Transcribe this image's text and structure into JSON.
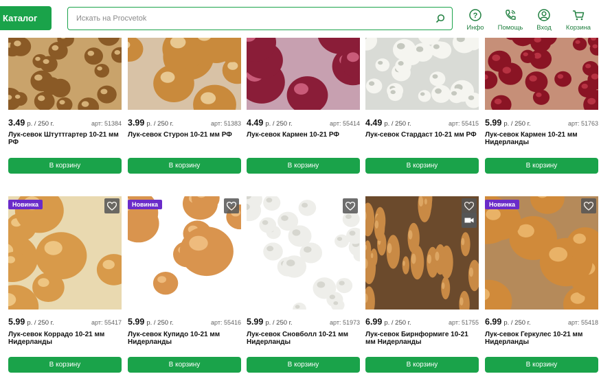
{
  "header": {
    "catalog_label": "Каталог",
    "search_placeholder": "Искать на Procvetok",
    "nav": [
      {
        "label": "Инфо",
        "icon": "info-icon"
      },
      {
        "label": "Помощь",
        "icon": "phone-icon"
      },
      {
        "label": "Вход",
        "icon": "user-icon"
      },
      {
        "label": "Корзина",
        "icon": "cart-icon"
      }
    ]
  },
  "colors": {
    "accent": "#1aa34a",
    "badge": "#6a2bc9"
  },
  "products": [
    {
      "price": "3.49",
      "unit": "р. / 250 г.",
      "art": "арт: 51384",
      "name": "Лук-севок Штуттгартер 10-21 мм РФ",
      "button": "В корзину",
      "image": "yellow-onion-sets"
    },
    {
      "price": "3.99",
      "unit": "р. / 250 г.",
      "art": "арт: 51383",
      "name": "Лук-севок Стурон 10-21 мм РФ",
      "button": "В корзину",
      "image": "golden-onions"
    },
    {
      "price": "4.49",
      "unit": "р. / 250 г.",
      "art": "арт: 55414",
      "name": "Лук-севок Кармен 10-21 РФ",
      "button": "В корзину",
      "image": "red-onion"
    },
    {
      "price": "4.49",
      "unit": "р. / 250 г.",
      "art": "арт: 55415",
      "name": "Лук-севок Стардаст 10-21 мм РФ",
      "button": "В корзину",
      "image": "white-onions"
    },
    {
      "price": "5.99",
      "unit": "р. / 250 г.",
      "art": "арт: 51763",
      "name": "Лук-севок Кармен 10-21 мм Нидерланды",
      "button": "В корзину",
      "image": "red-onions"
    },
    {
      "price": "5.99",
      "unit": "р. / 250 г.",
      "art": "арт: 55417",
      "name": "Лук-севок Коррадо 10-21 мм Нидерланды",
      "button": "В корзину",
      "image": "golden-onions-large",
      "badge": "Новинка",
      "heart": true
    },
    {
      "price": "5.99",
      "unit": "р. / 250 г.",
      "art": "арт: 55416",
      "name": "Лук-севок Купидо 10-21 мм Нидерланды",
      "button": "В корзину",
      "image": "onions-on-white",
      "badge": "Новинка",
      "heart": true
    },
    {
      "price": "5.99",
      "unit": "р. / 250 г.",
      "art": "арт: 51973",
      "name": "Лук-севок Сновболл 10-21 мм Нидерланды",
      "button": "В корзину",
      "image": "white-onion-sets",
      "heart": true
    },
    {
      "price": "6.99",
      "unit": "р. / 250 г.",
      "art": "арт: 51755",
      "name": "Лук-севок Бирнформиге 10-21 мм Нидерланды",
      "button": "В корзину",
      "image": "elongated-shallots",
      "heart": true,
      "video": true
    },
    {
      "price": "6.99",
      "unit": "р. / 250 г.",
      "art": "арт: 55418",
      "name": "Лук-севок Геркулес 10-21 мм Нидерланды",
      "button": "В корзину",
      "image": "golden-onions-sack",
      "badge": "Новинка",
      "heart": true
    }
  ]
}
